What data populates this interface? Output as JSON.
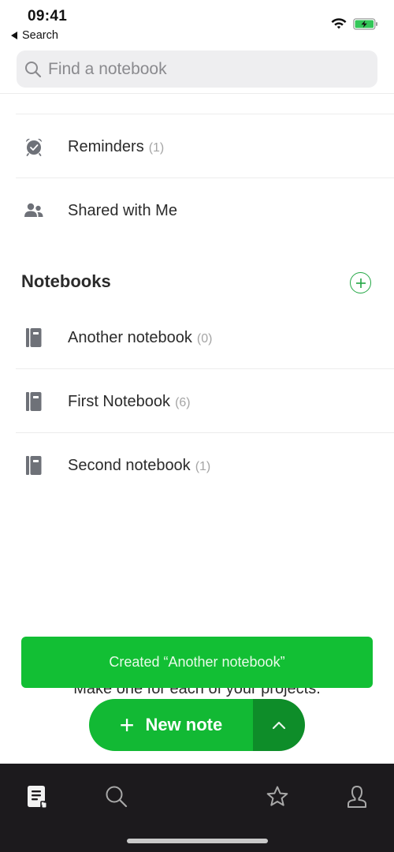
{
  "status_bar": {
    "time": "09:41",
    "back_label": "Search"
  },
  "search": {
    "placeholder": "Find a notebook"
  },
  "shortcuts": [
    {
      "label": "Reminders",
      "count": "(1)",
      "icon": "alarm-clock-check-icon"
    },
    {
      "label": "Shared with Me",
      "count": "",
      "icon": "people-icon"
    }
  ],
  "notebooks": {
    "title": "Notebooks",
    "add_icon": "plus-circle-icon",
    "items": [
      {
        "label": "Another notebook",
        "count": "(0)",
        "icon": "notebook-icon"
      },
      {
        "label": "First Notebook",
        "count": "(6)",
        "icon": "notebook-icon"
      },
      {
        "label": "Second notebook",
        "count": "(1)",
        "icon": "notebook-icon"
      }
    ]
  },
  "hint": "Make one for each of your projects.",
  "toast": {
    "message": "Created “Another notebook”"
  },
  "fab": {
    "label": "New note",
    "plus": "+"
  },
  "tab_bar": {
    "items": [
      {
        "name": "notes",
        "icon": "notes-icon",
        "active": true
      },
      {
        "name": "search",
        "icon": "search-icon",
        "active": false
      },
      {
        "name": "shortcuts",
        "icon": "star-icon",
        "active": false
      },
      {
        "name": "account",
        "icon": "person-icon",
        "active": false
      }
    ]
  },
  "colors": {
    "accent": "#12bf34",
    "accent_dark": "#0e8d29",
    "tab_bar_bg": "#1c1a1d",
    "icon_gray": "#6e7178"
  }
}
